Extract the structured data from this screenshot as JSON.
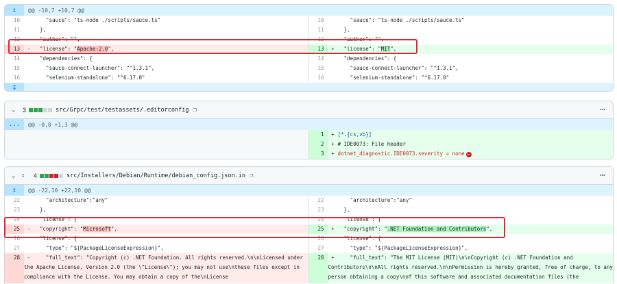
{
  "file1": {
    "hunk": "@@ -10,7 +10,7 @@",
    "rows": [
      {
        "l": {
          "n": "10",
          "text": "    \"sauce\": \"ts-node ./scripts/sauce.ts\""
        },
        "r": {
          "n": "10",
          "text": "    \"sauce\": \"ts-node ./scripts/sauce.ts\""
        }
      },
      {
        "l": {
          "n": "11",
          "text": "  },"
        },
        "r": {
          "n": "11",
          "text": "  },"
        }
      },
      {
        "l": {
          "n": "12",
          "text": "  \"author\": \"\","
        },
        "r": {
          "n": "12",
          "text": "  \"author\": \"\","
        }
      },
      {
        "l": {
          "n": "13",
          "pre": "  \"license\": \"",
          "hl": "Apache-2.0",
          "post": "\","
        },
        "r": {
          "n": "13",
          "pre": "  \"license\": \"",
          "hl": "MIT",
          "post": "\","
        }
      },
      {
        "l": {
          "n": "14",
          "text": "  \"dependencies\": {"
        },
        "r": {
          "n": "14",
          "text": "  \"dependencies\": {"
        }
      },
      {
        "l": {
          "n": "15",
          "text": "    \"sauce-connect-launcher\": \"^1.3.1\","
        },
        "r": {
          "n": "15",
          "text": "    \"sauce-connect-launcher\": \"^1.3.1\","
        }
      },
      {
        "l": {
          "n": "16",
          "text": "    \"selenium-standalone\": \"^6.17.0\""
        },
        "r": {
          "n": "16",
          "text": "    \"selenium-standalone\": \"^6.17.0\""
        }
      }
    ]
  },
  "file2": {
    "count": "3",
    "path": "src/Grpc/test/testassets/.editorconfig",
    "hunk_expand": "...",
    "hunk": "@@ -0,0 +1,3 @@",
    "rows": [
      {
        "n": "1",
        "text": "[*.{cs,vb}]"
      },
      {
        "n": "2",
        "text": "# IDE0073: File header"
      },
      {
        "n": "3",
        "text": "dotnet_diagnostic.IDE0073.severity = none"
      }
    ]
  },
  "file3": {
    "count": "4",
    "path": "src/Installers/Debian/Runtime/debian_config.json.in",
    "hunk": "@@ -22,10 +22,10 @@",
    "rows": [
      {
        "l": {
          "n": "22",
          "text": "    \"architecture\":\"any\""
        },
        "r": {
          "n": "22",
          "text": "    \"architecture\":\"any\""
        }
      },
      {
        "l": {
          "n": "23",
          "text": "  },"
        },
        "r": {
          "n": "23",
          "text": "  },"
        }
      },
      {
        "l": {
          "n": "24",
          "text": "  \"license\": {"
        },
        "r": {
          "n": "24",
          "text": "  \"license\": {"
        }
      },
      {
        "l": {
          "n": "25",
          "pre": "  \"copyright\": \"",
          "hl": "Microsoft",
          "post": "\","
        },
        "r": {
          "n": "25",
          "pre": "  \"copyright\": \"",
          "hl": ".NET Foundation and Contributors",
          "post": "\","
        }
      },
      {
        "l": {
          "n": "26",
          "text": "  \"license\": {"
        },
        "r": {
          "n": "26",
          "text": "  \"license\": {"
        }
      },
      {
        "l": {
          "n": "27",
          "text": "    \"type\": \"${PackageLicenseExpression}\","
        },
        "r": {
          "n": "27",
          "text": "    \"type\": \"${PackageLicenseExpression}\","
        }
      }
    ],
    "wrap": {
      "l": {
        "n": "28",
        "text": "    \"full_text\": \"Copyright (c) .NET Foundation. All rights reserved.\\n\\nLicensed under the Apache License, Version 2.0 (the \\\"License\\\"); you may not use\\nthese files except in compliance with the License. You may obtain a copy of the\\nLicense"
      },
      "r": {
        "n": "28",
        "text": "    \"full_text\": \"The MIT License (MIT)\\n\\nCopyright (c) .NET Foundation and Contributors\\n\\nAll rights reserved.\\n\\nPermission is hereby granted, free of charge, to any person obtaining a copy\\nof this software and associated documentation files (the \\\"Software\\\"), to deal\\nin the"
      }
    }
  },
  "icons": {
    "expand_up": "expand-up-icon",
    "expand_down": "expand-down-icon",
    "chevron": "chevron-down-icon",
    "copy": "copy-icon",
    "kebab": "kebab-icon",
    "stop": "no-newline-icon",
    "expand_all": "expand-all-icon"
  },
  "colors": {
    "added": "#e6ffec",
    "removed": "#ffebe9",
    "hunk": "#ddf4ff",
    "highlight_box": "#e0272e"
  }
}
